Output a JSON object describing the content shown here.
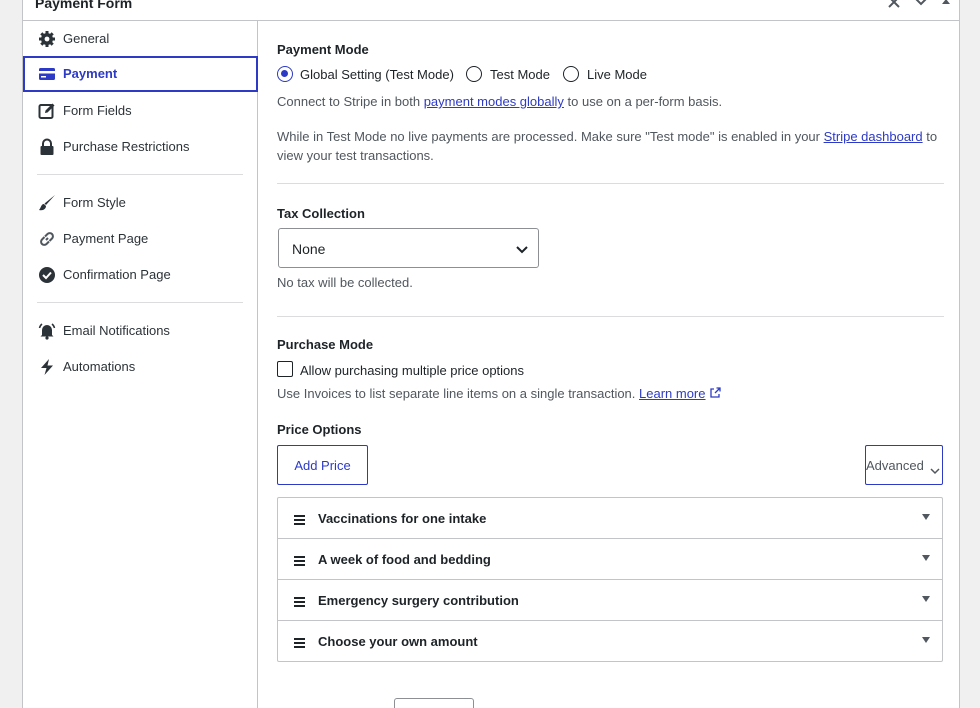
{
  "panel": {
    "title": "Payment Form"
  },
  "sidebar": {
    "items": [
      {
        "label": "General",
        "icon": "gear-icon"
      },
      {
        "label": "Payment",
        "icon": "credit-card-icon",
        "active": true
      },
      {
        "label": "Form Fields",
        "icon": "edit-icon"
      },
      {
        "label": "Purchase Restrictions",
        "icon": "lock-icon"
      },
      {
        "label": "Form Style",
        "icon": "brush-icon"
      },
      {
        "label": "Payment Page",
        "icon": "link-icon"
      },
      {
        "label": "Confirmation Page",
        "icon": "check-circle-icon"
      },
      {
        "label": "Email Notifications",
        "icon": "bell-icon"
      },
      {
        "label": "Automations",
        "icon": "bolt-icon"
      }
    ]
  },
  "payment_mode": {
    "label": "Payment Mode",
    "options": [
      {
        "label": "Global Setting (Test Mode)",
        "checked": true
      },
      {
        "label": "Test Mode",
        "checked": false
      },
      {
        "label": "Live Mode",
        "checked": false
      }
    ],
    "help_pre": "Connect to Stripe in both ",
    "help_link": "payment modes globally",
    "help_post": " to use on a per-form basis.",
    "test_help_pre": "While in Test Mode no live payments are processed. Make sure \"Test mode\" is enabled in your ",
    "test_help_link": "Stripe dashboard",
    "test_help_post": " to view your test transactions."
  },
  "tax": {
    "label": "Tax Collection",
    "selected": "None",
    "help": "No tax will be collected."
  },
  "purchase_mode": {
    "label": "Purchase Mode",
    "checkbox_label": "Allow purchasing multiple price options",
    "checked": false,
    "help_pre": "Use Invoices to list separate line items on a single transaction. ",
    "help_link": "Learn more"
  },
  "price_options": {
    "label": "Price Options",
    "add_label": "Add Price",
    "advanced_label": "Advanced",
    "items": [
      {
        "name": "Vaccinations for one intake"
      },
      {
        "name": "A week of food and bedding"
      },
      {
        "name": "Emergency surgery contribution"
      },
      {
        "name": "Choose your own amount"
      }
    ]
  },
  "colors": {
    "accent": "#2d3ac6",
    "border": "#c3c4c7",
    "text": "#1d2327",
    "muted": "#50575e"
  }
}
